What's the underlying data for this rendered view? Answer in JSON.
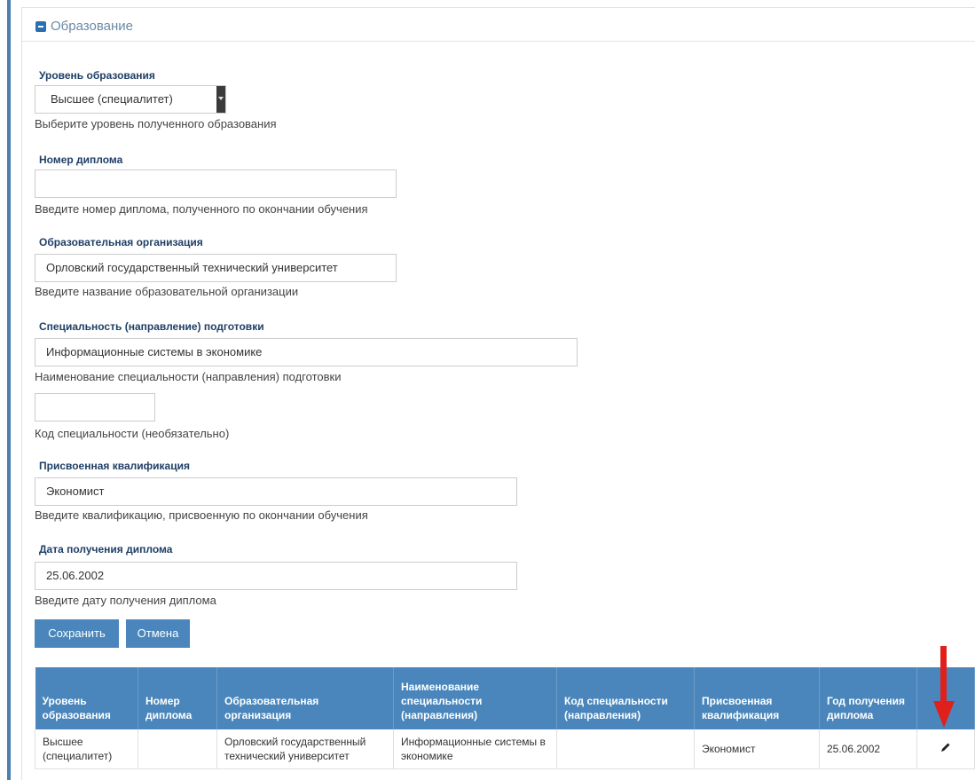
{
  "panel": {
    "title": "Образование"
  },
  "fields": {
    "education_level": {
      "label": "Уровень образования",
      "value": "Высшее (специалитет)",
      "help": "Выберите уровень полученного образования"
    },
    "diploma_number": {
      "label": "Номер диплома",
      "value": "",
      "help": "Введите номер диплома, полученного по окончании обучения"
    },
    "organization": {
      "label": "Образовательная организация",
      "value": "Орловский государственный технический университет",
      "help": "Введите название образовательной организации"
    },
    "specialty": {
      "label": "Специальность (направление) подготовки",
      "value": "Информационные системы в экономике",
      "help": "Наименование специальности (направления) подготовки"
    },
    "specialty_code": {
      "value": "",
      "help": "Код специальности (необязательно)"
    },
    "qualification": {
      "label": "Присвоенная квалификация",
      "value": "Экономист",
      "help": "Введите квалификацию, присвоенную по окончании обучения"
    },
    "diploma_date": {
      "label": "Дата получения диплома",
      "value": "25.06.2002",
      "help": "Введите дату получения диплома"
    }
  },
  "buttons": {
    "save": "Сохранить",
    "cancel": "Отмена"
  },
  "table": {
    "headers": [
      "Уровень образования",
      "Номер диплома",
      "Образовательная организация",
      "Наименование специальности (направления)",
      "Код специальности (направления)",
      "Присвоенная квалификация",
      "Год получения диплома",
      ""
    ],
    "rows": [
      {
        "level": "Высшее (специалитет)",
        "number": "",
        "organization": "Орловский государственный технический университет",
        "specialty": "Информационные системы в экономике",
        "code": "",
        "qualification": "Экономист",
        "date": "25.06.2002",
        "action_icon": "pencil-icon"
      }
    ]
  },
  "colors": {
    "accent": "#4a86bb",
    "label": "#1f3f66",
    "annotation_arrow": "#e0201b"
  }
}
